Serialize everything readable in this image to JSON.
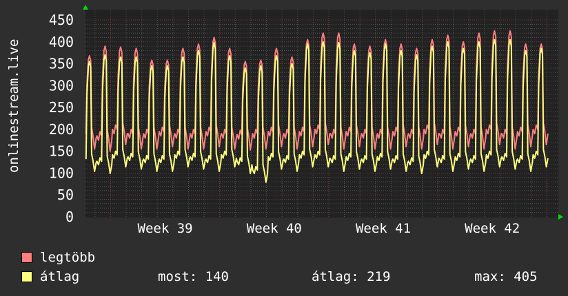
{
  "chart_data": {
    "type": "line",
    "ylabel": "onlinestream.live",
    "ylim": [
      0,
      450
    ],
    "yticks": [
      "0",
      "50",
      "100",
      "150",
      "200",
      "250",
      "300",
      "350",
      "400",
      "450"
    ],
    "xticks": [
      "Week 39",
      "Week 40",
      "Week 41",
      "Week 42"
    ],
    "grid": true,
    "legend_placement": "bottom",
    "x_unit": "day",
    "series": [
      {
        "name": "legtöbb",
        "color": "#ff7f7f",
        "daily_peak": [
          368,
          390,
          388,
          385,
          358,
          358,
          385,
          395,
          410,
          385,
          355,
          358,
          385,
          365,
          405,
          420,
          420,
          395,
          390,
          405,
          395,
          385,
          405,
          415,
          400,
          420,
          425,
          425,
          395,
          395
        ],
        "daily_low": [
          150,
          145,
          160,
          150,
          150,
          155,
          150,
          150,
          155,
          150,
          148,
          150,
          155,
          150,
          155,
          160,
          150,
          155,
          150,
          150,
          155,
          150,
          160,
          150,
          155,
          150,
          160,
          150,
          155,
          160
        ]
      },
      {
        "name": "átlag",
        "color": "#ffff7f",
        "daily_peak": [
          355,
          370,
          365,
          365,
          345,
          345,
          365,
          380,
          398,
          368,
          340,
          345,
          368,
          350,
          395,
          400,
          398,
          380,
          375,
          395,
          380,
          370,
          390,
          400,
          385,
          400,
          405,
          405,
          380,
          385
        ],
        "daily_low": [
          100,
          95,
          110,
          105,
          100,
          100,
          110,
          105,
          100,
          110,
          95,
          75,
          105,
          100,
          110,
          110,
          100,
          105,
          100,
          105,
          100,
          95,
          110,
          100,
          105,
          100,
          110,
          105,
          100,
          110
        ]
      }
    ]
  },
  "legend": {
    "items": [
      {
        "label": "legtöbb",
        "color": "#ff7f7f"
      },
      {
        "label": "átlag",
        "color": "#ffff7f"
      }
    ],
    "stats": {
      "now": "most: 140",
      "avg": "átlag: 219",
      "max": "max: 405"
    }
  }
}
